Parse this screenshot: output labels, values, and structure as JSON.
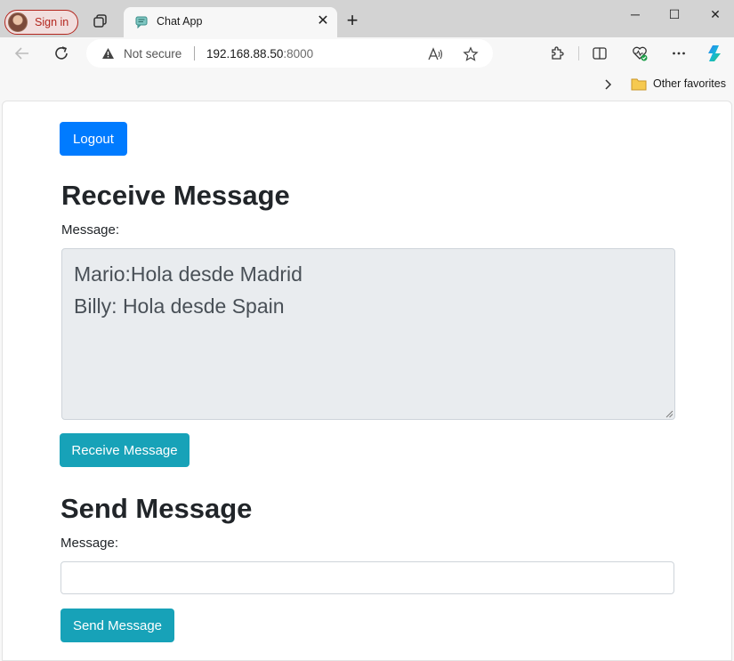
{
  "browser": {
    "sign_in_label": "Sign in",
    "tab_title": "Chat App",
    "security_label": "Not secure",
    "url_host": "192.168.88.50",
    "url_port": ":8000",
    "favorites_label": "Other favorites"
  },
  "page": {
    "logout_label": "Logout",
    "receive": {
      "heading": "Receive Message",
      "field_label": "Message:",
      "messages": [
        "Mario:Hola desde Madrid",
        "Billy: Hola desde Spain"
      ],
      "button_label": "Receive Message"
    },
    "send": {
      "heading": "Send Message",
      "field_label": "Message:",
      "input_value": "",
      "button_label": "Send Message"
    }
  },
  "colors": {
    "primary": "#007bff",
    "info": "#17a2b8",
    "readonly_bg": "#e9ecef"
  }
}
